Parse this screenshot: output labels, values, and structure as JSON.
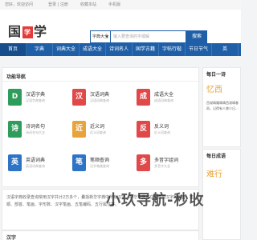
{
  "topbar": {
    "links": [
      "您好，欢迎访问",
      "登录 | 注册",
      "收藏本站",
      "手机版"
    ]
  },
  "header": {
    "logo_left": "国",
    "logo_red": "学",
    "logo_right": "学"
  },
  "search": {
    "type_label": "字典大全",
    "placeholder": "输入要查询的字或解",
    "button": "搜索"
  },
  "nav": {
    "items": [
      "首页",
      "字典",
      "词典大全",
      "成语大全",
      "诗词名人",
      "国学古籍",
      "字帖行楷",
      "节日节气",
      "英"
    ]
  },
  "tools": {
    "title": "功能导航",
    "items": [
      {
        "icon": "D",
        "name": "汉语字典",
        "desc": "汉语字典查询",
        "color": "#2e9c5b"
      },
      {
        "icon": "汉",
        "name": "汉语词典",
        "desc": "汉语词典查询",
        "color": "#e0494a"
      },
      {
        "icon": "成",
        "name": "成语大全",
        "desc": "成语词典查询",
        "color": "#e0494a"
      },
      {
        "icon": "诗",
        "name": "诗词名句",
        "desc": "诗词名句大全",
        "color": "#2e9c5b"
      },
      {
        "icon": "近",
        "name": "近义词",
        "desc": "近义词查询",
        "color": "#e8a33a"
      },
      {
        "icon": "反",
        "name": "反义词",
        "desc": "反义词查询",
        "color": "#e0494a"
      },
      {
        "icon": "英",
        "name": "英语词典",
        "desc": "英语词典查询",
        "color": "#2d73c6"
      },
      {
        "icon": "笔",
        "name": "笔顺查询",
        "desc": "汉字笔顺查询",
        "color": "#2d73c6"
      },
      {
        "icon": "多",
        "name": "多音字组词",
        "desc": "多音字大全",
        "color": "#e0494a"
      }
    ]
  },
  "intro": {
    "text": "汉语字典收录查询常用汉字共计2万多个，囊括新华字典中所有汉字，新华字典可在线查询汉字的拼音、笔顺、部首、笔画、字形数、汉字笔画、五笔编码、五行属性等。",
    "section_title": "汉字"
  },
  "side": {
    "title": "每日一诗",
    "poem_title": "忆西",
    "poem_text": "西湖晴耀晴晴西湖晴春雨，记得有人曾少日..."
  },
  "side2": {
    "title": "每日成语",
    "word": "难行"
  },
  "watermark": {
    "text": "小玖导航-秒收"
  },
  "colors": {
    "brand_blue": "#1f5fa8",
    "accent_orange": "#e8a33a",
    "accent_red": "#e43a3a"
  }
}
